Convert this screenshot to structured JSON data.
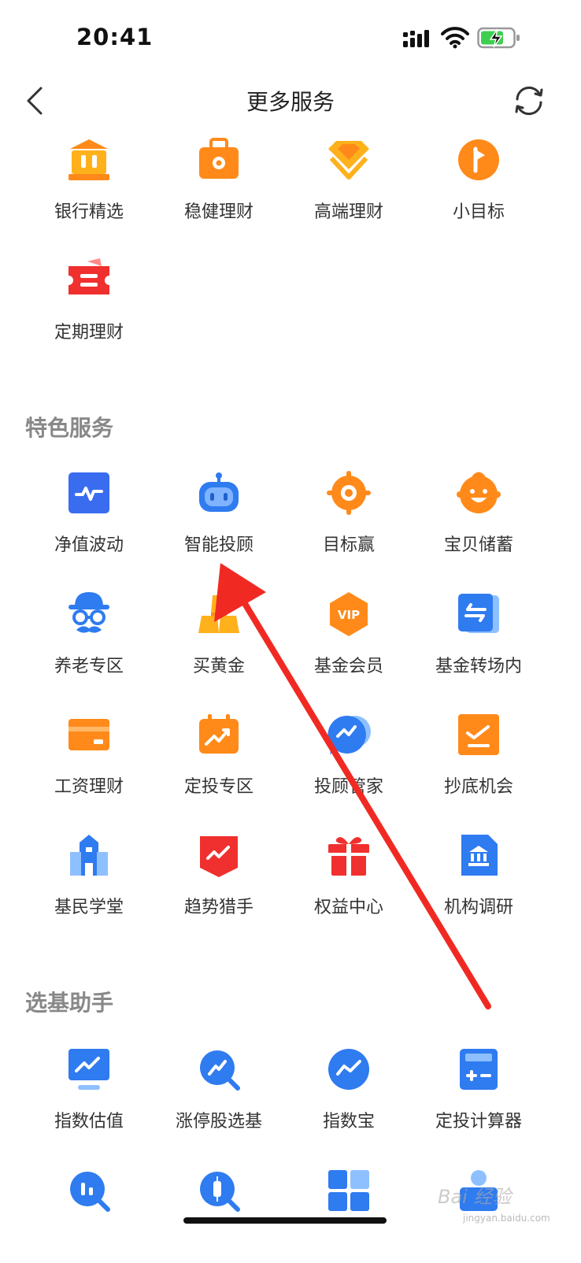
{
  "status_bar": {
    "time": "20:41"
  },
  "nav": {
    "title": "更多服务"
  },
  "top_items": [
    {
      "label": "银行精选"
    },
    {
      "label": "稳健理财"
    },
    {
      "label": "高端理财"
    },
    {
      "label": "小目标"
    },
    {
      "label": "定期理财"
    }
  ],
  "special": {
    "title": "特色服务",
    "items": [
      {
        "label": "净值波动"
      },
      {
        "label": "智能投顾"
      },
      {
        "label": "目标赢"
      },
      {
        "label": "宝贝储蓄"
      },
      {
        "label": "养老专区"
      },
      {
        "label": "买黄金"
      },
      {
        "label": "基金会员"
      },
      {
        "label": "基金转场内"
      },
      {
        "label": "工资理财"
      },
      {
        "label": "定投专区"
      },
      {
        "label": "投顾管家"
      },
      {
        "label": "抄底机会"
      },
      {
        "label": "基民学堂"
      },
      {
        "label": "趋势猎手"
      },
      {
        "label": "权益中心"
      },
      {
        "label": "机构调研"
      }
    ]
  },
  "helper": {
    "title": "选基助手",
    "items": [
      {
        "label": "指数估值"
      },
      {
        "label": "涨停股选基"
      },
      {
        "label": "指数宝"
      },
      {
        "label": "定投计算器"
      }
    ]
  },
  "watermark": {
    "text": "Bai 经验",
    "url": "jingyan.baidu.com"
  },
  "badges": {
    "vip": "VIP"
  },
  "colors": {
    "orange": "#FF8A1A",
    "blue": "#2F7BF0",
    "red": "#F0302E",
    "arrow": "#F02A23"
  }
}
